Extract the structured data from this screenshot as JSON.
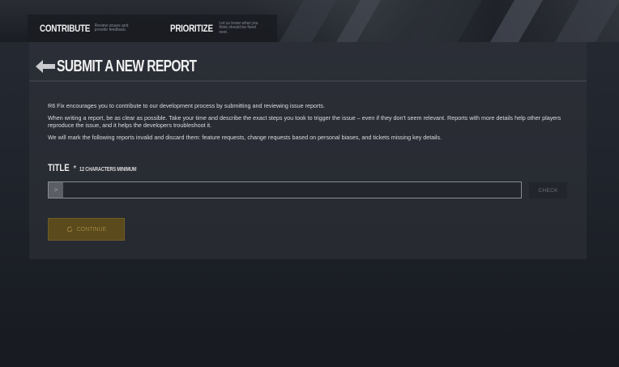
{
  "nav": {
    "items": [
      {
        "label": "CONTRIBUTE",
        "description": "Review issues and provide feedback."
      },
      {
        "label": "PRIORITIZE",
        "description": "Let us know what you think should be fixed next."
      }
    ]
  },
  "header": {
    "title": "SUBMIT A NEW REPORT",
    "back_icon": "arrow-left-icon"
  },
  "intro": {
    "paragraph1": "R6 Fix encourages you to contribute to our development process by submitting and reviewing issue reports.",
    "paragraph2": "When writing a report, be as clear as possible. Take your time and describe the exact steps you took to trigger the issue – even if they don't seem relevant. Reports with more details help other players reproduce the issue, and it helps the developers troubleshoot it.",
    "paragraph3": "We will mark the following reports invalid and discard them: feature requests, change requests based on personal biases, and tickets missing key details."
  },
  "form": {
    "title_label": "TITLE",
    "required_mark": "*",
    "title_hint": "12 CHARACTERS MINIMUM",
    "input_prefix": ">",
    "title_value": "",
    "check_label": "CHECK",
    "continue_label": "CONTINUE",
    "continue_icon": "refresh-icon"
  },
  "colors": {
    "accent": "#5a4a1c",
    "accent_text": "#a08640",
    "panel": "#2b2e36",
    "background": "#1c1f26"
  }
}
